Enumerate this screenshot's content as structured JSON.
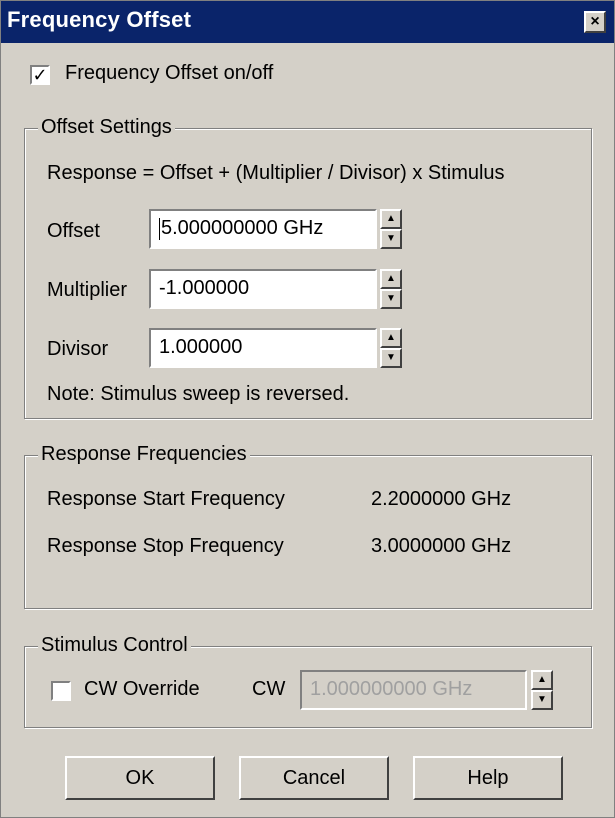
{
  "window": {
    "title": "Frequency Offset",
    "close_glyph": "×"
  },
  "offset_toggle": {
    "label": "Frequency Offset on/off",
    "checked": true,
    "check_glyph": "✓"
  },
  "offset_settings": {
    "legend": "Offset Settings",
    "formula": "Response  =  Offset + (Multiplier / Divisor) x Stimulus",
    "offset": {
      "label": "Offset",
      "value": "5.000000000 GHz"
    },
    "multiplier": {
      "label": "Multiplier",
      "value": "-1.000000"
    },
    "divisor": {
      "label": "Divisor",
      "value": "1.000000"
    },
    "note": "Note: Stimulus sweep is reversed.",
    "spin_up_glyph": "▲",
    "spin_down_glyph": "▼"
  },
  "response_frequencies": {
    "legend": "Response Frequencies",
    "start": {
      "label": "Response Start Frequency",
      "value": "2.2000000 GHz"
    },
    "stop": {
      "label": "Response Stop Frequency",
      "value": "3.0000000 GHz"
    }
  },
  "stimulus_control": {
    "legend": "Stimulus Control",
    "cw_override_label": "CW Override",
    "cw_override_checked": false,
    "cw_label": "CW",
    "cw_value": "1.000000000 GHz"
  },
  "buttons": {
    "ok": "OK",
    "cancel": "Cancel",
    "help": "Help"
  },
  "colors": {
    "titlebar": "#0a246a",
    "face": "#d4d0c8",
    "disabled_text": "#a0a0a0"
  }
}
